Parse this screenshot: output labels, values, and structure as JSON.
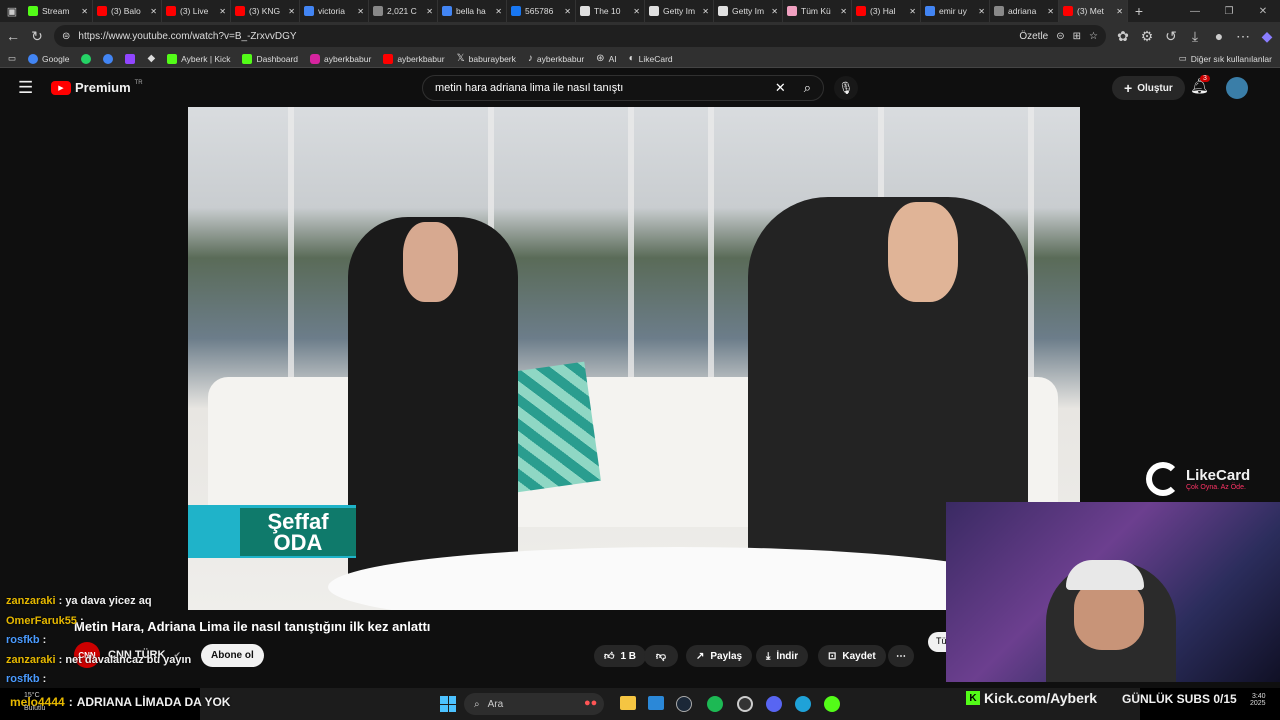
{
  "tabs": [
    {
      "label": "Stream",
      "color": "#53fc18",
      "active": false
    },
    {
      "label": "(3) Balo",
      "color": "#ff0000",
      "active": false
    },
    {
      "label": "(3) Live",
      "color": "#ff0000",
      "active": false
    },
    {
      "label": "(3) KNG",
      "color": "#ff0000",
      "active": false
    },
    {
      "label": "victoria",
      "color": "#4285f4",
      "active": false
    },
    {
      "label": "2,021 C",
      "color": "#888888",
      "active": false
    },
    {
      "label": "bella ha",
      "color": "#4285f4",
      "active": false
    },
    {
      "label": "565786",
      "color": "#1877f2",
      "active": false
    },
    {
      "label": "The 10",
      "color": "#e0e0e0",
      "active": false
    },
    {
      "label": "Getty Im",
      "color": "#e0e0e0",
      "active": false
    },
    {
      "label": "Getty Im",
      "color": "#e0e0e0",
      "active": false
    },
    {
      "label": "Tüm Kü",
      "color": "#f0a0c0",
      "active": false
    },
    {
      "label": "(3) Hal",
      "color": "#ff0000",
      "active": false
    },
    {
      "label": "emir uy",
      "color": "#4285f4",
      "active": false
    },
    {
      "label": "adriana",
      "color": "#888888",
      "active": false
    },
    {
      "label": "(3) Met",
      "color": "#ff0000",
      "active": true
    }
  ],
  "browser": {
    "url": "https://www.youtube.com/watch?v=B_-ZrxvvDGY",
    "summarize": "Özetle",
    "bookmarks": [
      "Google",
      "Ayberk | Kick",
      "Dashboard",
      "ayberkbabur",
      "ayberkbabur",
      "baburayberk",
      "ayberkbabur",
      "AI",
      "LikeCard"
    ],
    "other_bookmarks": "Diğer sık kullanılanlar"
  },
  "youtube": {
    "logo": "Premium",
    "region": "TR",
    "search_value": "metin hara adriana lima ile nasıl tanıştı",
    "create_label": "Oluştur",
    "notif_count": "3"
  },
  "video": {
    "show_logo_top": "Şeffaf",
    "show_logo_bottom": "ODA",
    "likecard_name": "LikeCard",
    "likecard_tag": "Çok Oyna. Az Öde.",
    "title": "Metin Hara, Adriana Lima ile nasıl tanıştığını ilk kez anlattı",
    "channel": "CNN TÜRK",
    "channel_logo": "CNN",
    "subscribe": "Abone ol",
    "likes": "1 B",
    "share": "Paylaş",
    "download": "İndir",
    "save": "Kaydet"
  },
  "chat": [
    {
      "user": "zanzaraki",
      "msg": "ya dava yicez aq",
      "color": "#e6b800"
    },
    {
      "user": "OmerFaruk55",
      "msg": "",
      "color": "#e6b800"
    },
    {
      "user": "rosfkb",
      "msg": "",
      "color": "#4a9bff"
    },
    {
      "user": "zanzaraki",
      "msg": "net davalancaz bu yayın",
      "color": "#e6b800"
    },
    {
      "user": "rosfkb",
      "msg": "",
      "color": "#4a9bff"
    }
  ],
  "overlay": {
    "bottom_user": "melo4444",
    "bottom_msg": "ADRIANA LİMADA DA YOK",
    "kick": "Kick.com/Ayberk",
    "subs": "GÜNLÜK SUBS 0/15"
  },
  "taskbar": {
    "search": "Ara",
    "weather": "Bulutlu",
    "temp": "15°C",
    "time": "3:40",
    "year": "2025"
  }
}
